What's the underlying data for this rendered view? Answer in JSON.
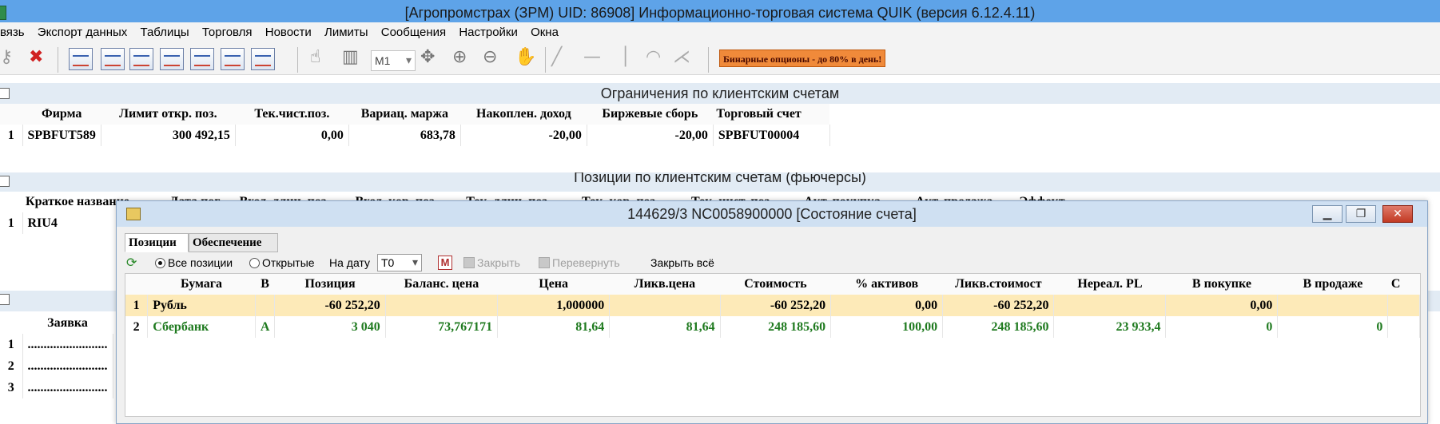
{
  "title": "[Агропромстрах (ЗРМ) UID: 86908] Информационно-торговая система QUIK (версия 6.12.4.11)",
  "menu": [
    "вязь",
    "Экспорт данных",
    "Таблицы",
    "Торговля",
    "Новости",
    "Лимиты",
    "Сообщения",
    "Настройки",
    "Окна"
  ],
  "toolbar": {
    "interval": "M1",
    "ad_text": "Бинарные опционы - до 80% в день!"
  },
  "limits_panel": {
    "title": "Ограничения по клиентским счетам",
    "headers": [
      "Фирма",
      "Лимит откр. поз.",
      "Тек.чист.поз.",
      "Вариац. маржа",
      "Накоплен. доход",
      "Биржевые сборь",
      "Торговый счет"
    ],
    "rows": [
      {
        "n": "1",
        "cells": [
          "SPBFUT589",
          "300 492,15",
          "0,00",
          "683,78",
          "-20,00",
          "-20,00",
          "SPBFUT00004"
        ]
      }
    ]
  },
  "positions_panel": {
    "title": "Позиции по клиентским счетам (фьючерсы)",
    "headers": [
      "Краткое название",
      "Дата пог",
      "Вход. длин. поз",
      "Вход. кор. поз",
      "Тек. длин. поз",
      "Тек. кор. поз",
      "Тек. чист. поз",
      "Акт. покупка",
      "Акт. продажа",
      "Эффект"
    ],
    "rows": [
      {
        "n": "1",
        "name": "RIU4"
      }
    ]
  },
  "orders_panel": {
    "header": "Заявка",
    "rows": [
      {
        "n": "1",
        "value": "........................."
      },
      {
        "n": "2",
        "value": "........................."
      },
      {
        "n": "3",
        "value": "........................."
      }
    ]
  },
  "account_window": {
    "title": "144629/3 NC0058900000 [Состояние счета]",
    "tabs": [
      "Позиции",
      "Обеспечение"
    ],
    "filters": {
      "all_positions": "Все позиции",
      "open": "Открытые",
      "on_date": "На дату",
      "date_value": "T0",
      "m_button": "M",
      "close": "Закрыть",
      "reverse": "Перевернуть",
      "close_all": "Закрыть всё"
    },
    "headers": [
      "Бумага",
      "В",
      "Позиция",
      "Баланс. цена",
      "Цена",
      "Ликв.цена",
      "Стоимость",
      "% активов",
      "Ликв.стоимост",
      "Нереал. PL",
      "В покупке",
      "В продаже",
      "С"
    ],
    "rows": [
      {
        "n": "1",
        "cells": [
          "Рубль",
          "",
          "-60 252,20",
          "",
          "1,000000",
          "",
          "-60 252,20",
          "0,00",
          "-60 252,20",
          "",
          "0,00",
          "",
          ""
        ]
      },
      {
        "n": "2",
        "cells": [
          "Сбербанк",
          "А",
          "3 040",
          "73,767171",
          "81,64",
          "81,64",
          "248 185,60",
          "100,00",
          "248 185,60",
          "23 933,4",
          "0",
          "0",
          ""
        ]
      }
    ]
  }
}
